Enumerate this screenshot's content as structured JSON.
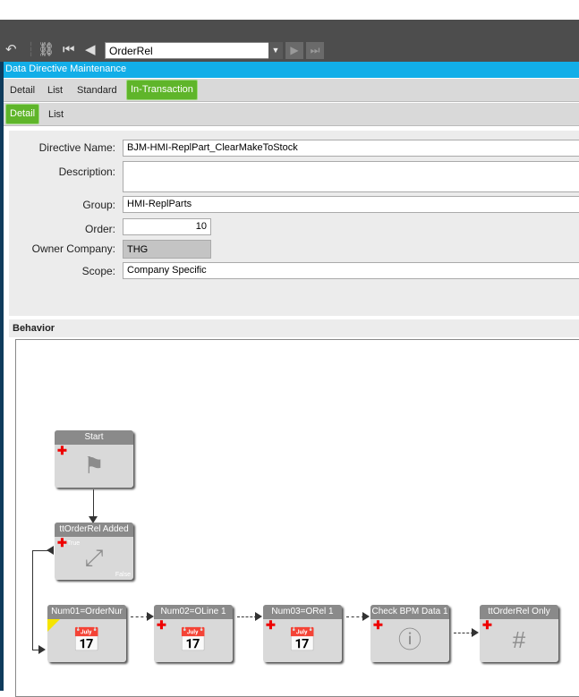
{
  "toolbar": {
    "combo_value": "OrderRel",
    "icons": [
      "undo-icon",
      "binoculars-icon",
      "first-record-icon",
      "previous-record-icon",
      "dropdown-icon",
      "next-record-icon",
      "last-record-icon"
    ]
  },
  "window": {
    "title": "Data Directive Maintenance"
  },
  "tabs": [
    {
      "label": "Detail"
    },
    {
      "label": "List"
    },
    {
      "label": "Standard"
    },
    {
      "label": "In-Transaction",
      "active": true
    }
  ],
  "subtabs": [
    {
      "label": "Detail",
      "active": true
    },
    {
      "label": "List"
    }
  ],
  "form": {
    "directive_name_label": "Directive Name:",
    "directive_name": "BJM-HMI-ReplPart_ClearMakeToStock",
    "description_label": "Description:",
    "description": "",
    "group_label": "Group:",
    "group": "HMI-ReplParts",
    "order_label": "Order:",
    "order": "10",
    "owner_company_label": "Owner Company:",
    "owner_company": "THG",
    "scope_label": "Scope:",
    "scope": "Company Specific"
  },
  "behavior": {
    "label": "Behavior",
    "nodes": [
      {
        "title": "Start",
        "icon": "flag-icon"
      },
      {
        "title": "ttOrderRel Added",
        "icon": "condition-icon",
        "true_label": "True",
        "false_label": "False"
      },
      {
        "title": "Num01=OrderNur",
        "icon": "calendar-icon"
      },
      {
        "title": "Num02=OLine 1",
        "icon": "calendar-icon"
      },
      {
        "title": "Num03=ORel 1",
        "icon": "calendar-icon"
      },
      {
        "title": "Check BPM Data 1",
        "icon": "info-icon"
      },
      {
        "title": "ttOrderRel Only",
        "icon": "hash-document-icon"
      }
    ]
  },
  "colors": {
    "accent_blue": "#12aee8",
    "active_tab": "#5fb52a",
    "toolbar": "#4d4d4d"
  }
}
